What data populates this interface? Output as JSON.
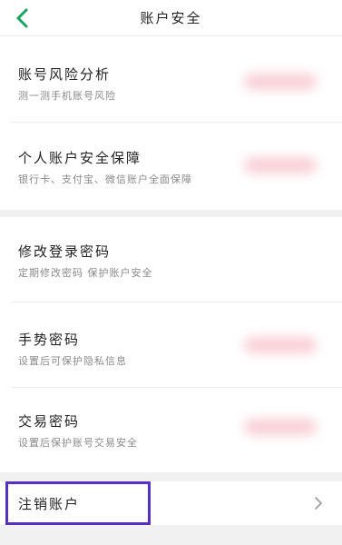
{
  "header": {
    "title": "账户安全",
    "back_icon": "chevron-left-icon",
    "accent_color": "#1aa260"
  },
  "items": [
    {
      "id": "risk-analysis",
      "title": "账号风险分析",
      "subtitle": "测一测手机账号风险"
    },
    {
      "id": "account-protection",
      "title": "个人账户安全保障",
      "subtitle": "银行卡、支付宝、微信账户全面保障"
    },
    {
      "id": "change-password",
      "title": "修改登录密码",
      "subtitle": "定期修改密码 保护账户安全"
    },
    {
      "id": "gesture-password",
      "title": "手势密码",
      "subtitle": "设置后可保护隐私信息"
    },
    {
      "id": "trade-password",
      "title": "交易密码",
      "subtitle": "设置后保护账号交易安全"
    }
  ],
  "cancel_account": {
    "title": "注销账户",
    "chevron_icon": "chevron-right-icon",
    "highlight_color": "#5630c3"
  }
}
